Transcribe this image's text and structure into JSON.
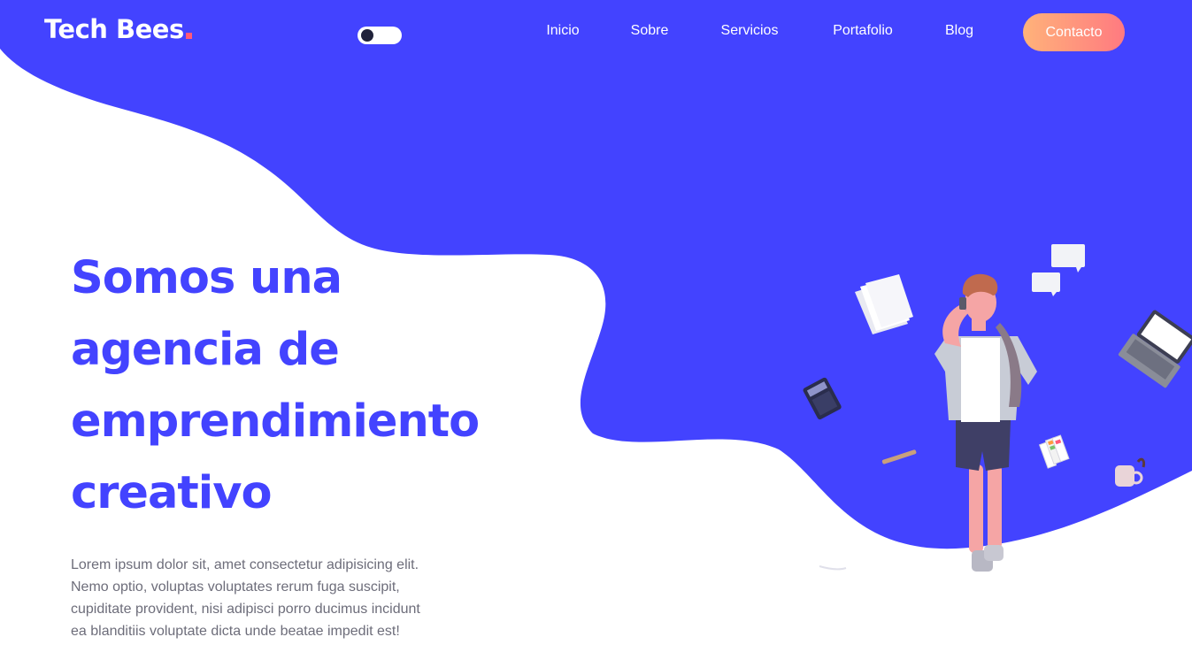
{
  "brand": {
    "name": "Tech Bees",
    "accent_dot_color": "#ff5a78"
  },
  "theme_toggle": {
    "state": "off"
  },
  "nav": {
    "items": [
      {
        "label": "Inicio"
      },
      {
        "label": "Sobre"
      },
      {
        "label": "Servicios"
      },
      {
        "label": "Portafolio"
      },
      {
        "label": "Blog"
      }
    ],
    "cta_label": "Contacto"
  },
  "hero": {
    "title_lines": [
      "Somos una",
      "agencia de",
      "emprendimiento",
      "creativo"
    ],
    "paragraph_lines": [
      "Lorem ipsum dolor sit, amet consectetur adipisicing elit.",
      "Nemo optio, voluptas voluptates rerum fuga suscipit,",
      "cupiditate provident, nisi adipisci porro ducimus incidunt",
      "ea blanditiis voluptate dicta unde beatae impedit est!"
    ]
  },
  "colors": {
    "primary": "#4343ff",
    "cta_gradient_start": "#ffb27a",
    "cta_gradient_end": "#ff7a80",
    "body_text": "#6d6d7a",
    "background": "#ffffff"
  },
  "illustration": {
    "icons": [
      "person-on-phone-icon",
      "speech-bubble-icon",
      "papers-icon",
      "laptop-icon",
      "calculator-icon",
      "pencil-icon",
      "color-swatch-icon",
      "coffee-mug-icon"
    ]
  }
}
